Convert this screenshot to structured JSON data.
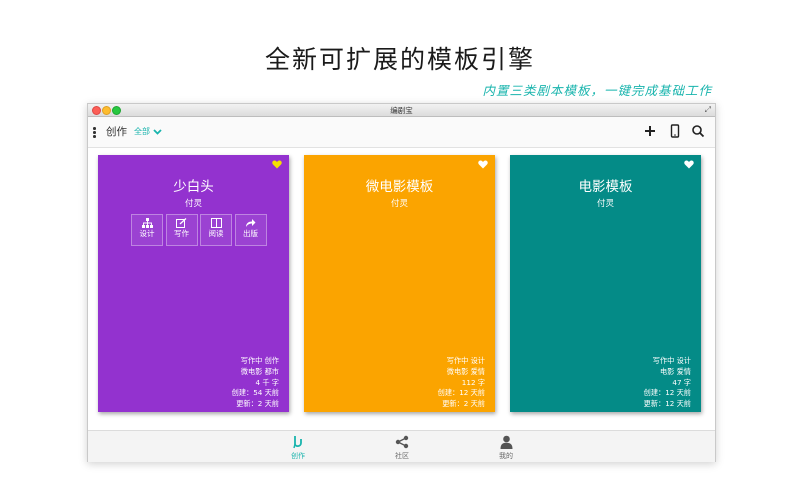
{
  "promo": {
    "headline": "全新可扩展的模板引擎",
    "subline": "内置三类剧本模板，一键完成基础工作"
  },
  "window": {
    "title": "编剧宝"
  },
  "toolbar": {
    "section_title": "创作",
    "filter_label": "全部",
    "icons": [
      "menu-icon",
      "plus-icon",
      "phone-icon",
      "search-icon"
    ]
  },
  "colors": {
    "accent": "#19b4ad",
    "purple": "#9332cf",
    "orange": "#fba400",
    "teal": "#048b87",
    "heart_active": "#f5e000"
  },
  "cards": [
    {
      "title": "少白头",
      "author": "付灵",
      "favorited": true,
      "actions": [
        {
          "icon": "sitemap-icon",
          "label": "设计"
        },
        {
          "icon": "edit-icon",
          "label": "写作"
        },
        {
          "icon": "book-icon",
          "label": "阅读"
        },
        {
          "icon": "share-icon",
          "label": "出版"
        }
      ],
      "meta": [
        "写作中 创作",
        "微电影 都市",
        "4 千 字",
        "创建：54 天前",
        "更新：2 天前"
      ]
    },
    {
      "title": "微电影模板",
      "author": "付灵",
      "favorited": false,
      "meta": [
        "写作中 设计",
        "微电影 爱情",
        "112 字",
        "创建：12 天前",
        "更新：2 天前"
      ]
    },
    {
      "title": "电影模板",
      "author": "付灵",
      "favorited": false,
      "meta": [
        "写作中 设计",
        "电影 爱情",
        "47 字",
        "创建：12 天前",
        "更新：12 天前"
      ]
    }
  ],
  "bottom_nav": [
    {
      "icon": "pen-icon",
      "label": "创作",
      "active": true
    },
    {
      "icon": "share-icon",
      "label": "社区",
      "active": false
    },
    {
      "icon": "user-icon",
      "label": "我的",
      "active": false
    }
  ]
}
